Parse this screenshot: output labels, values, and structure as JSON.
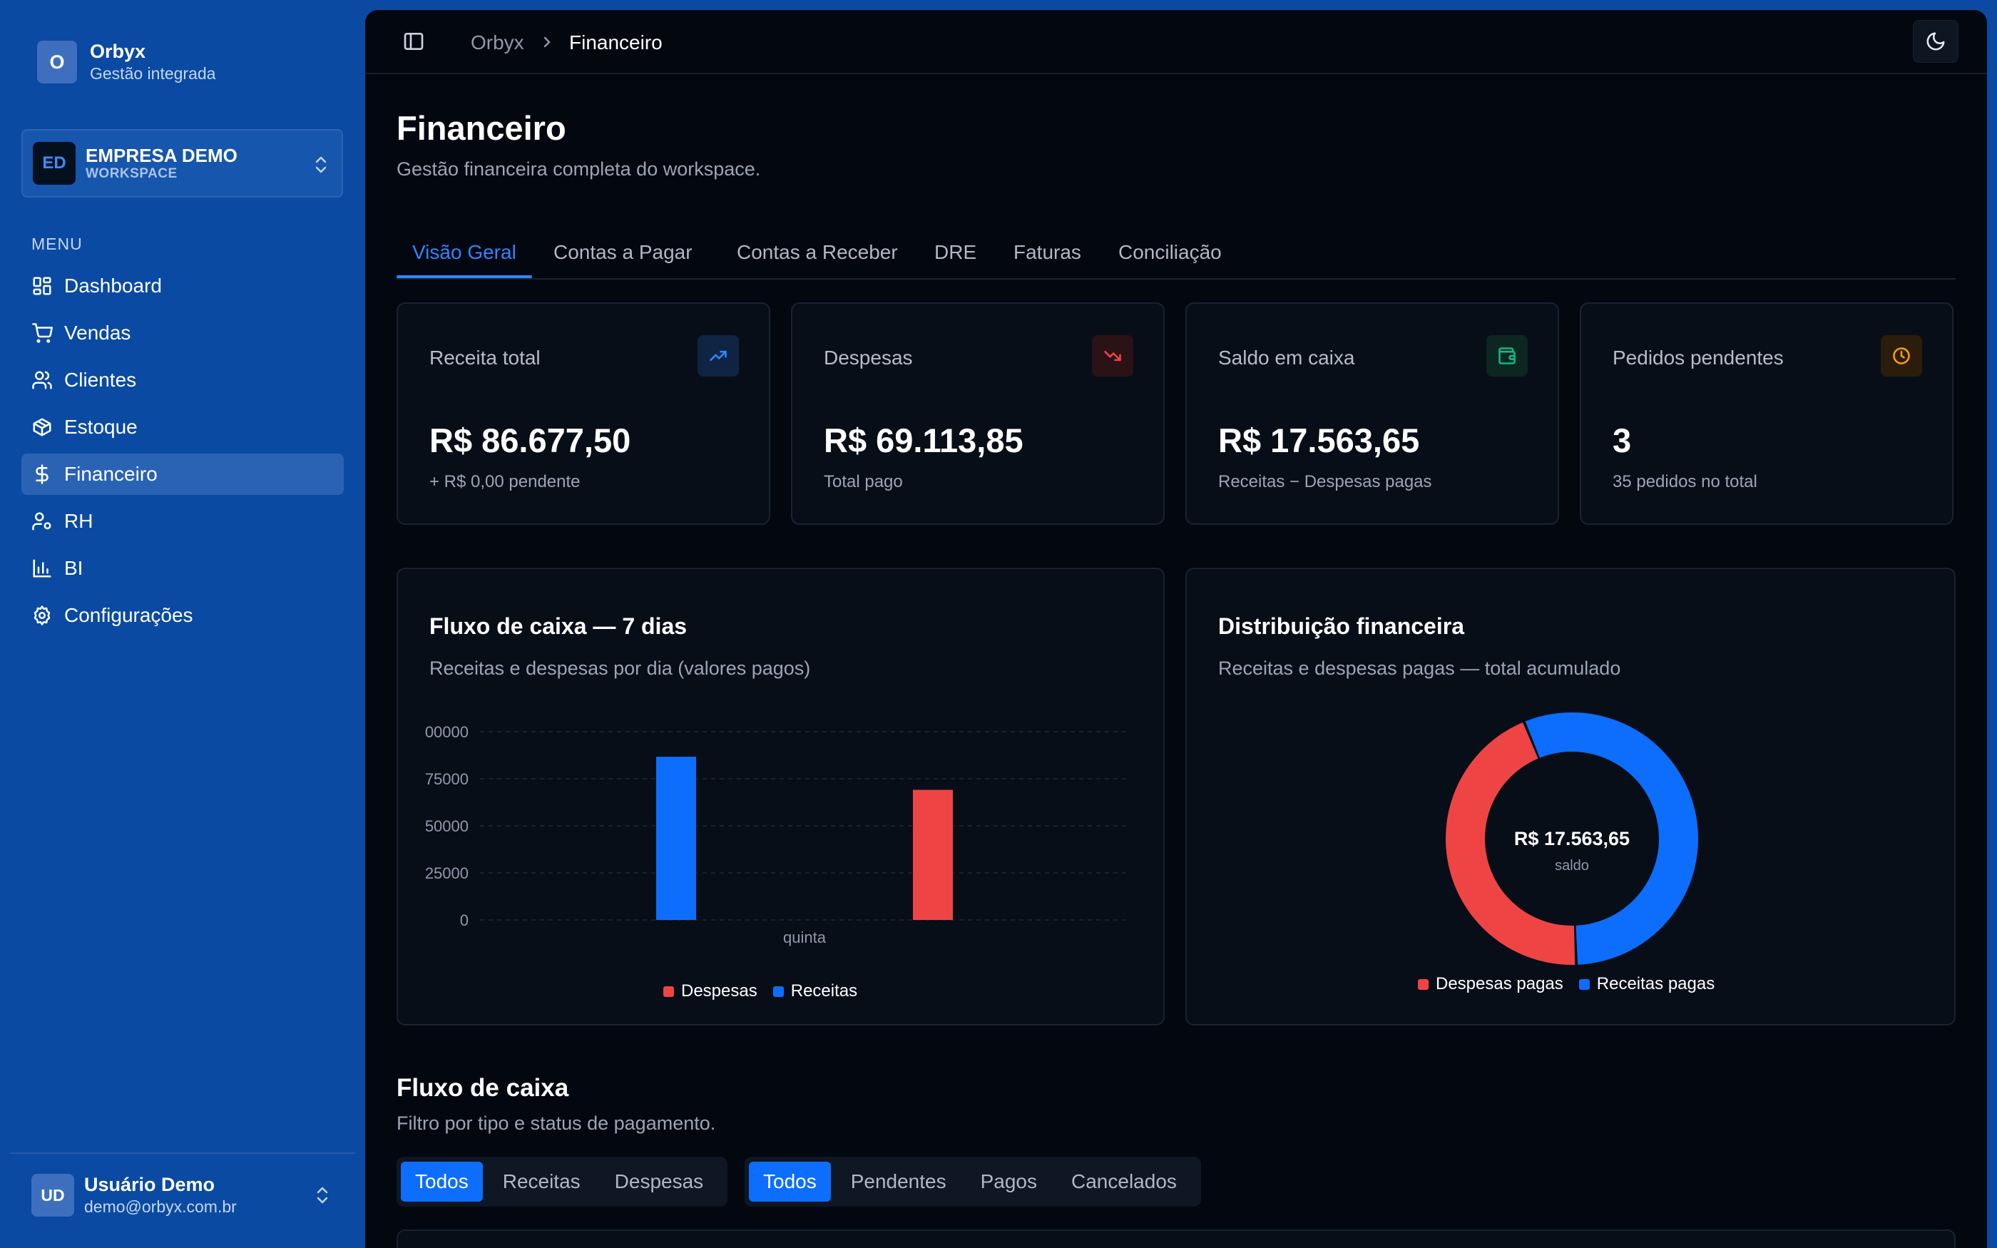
{
  "brand": {
    "initial": "O",
    "name": "Orbyx",
    "subtitle": "Gestão integrada"
  },
  "workspace": {
    "initials": "ED",
    "name": "EMPRESA DEMO",
    "label": "WORKSPACE"
  },
  "menu": {
    "label": "MENU",
    "items": [
      {
        "label": "Dashboard",
        "icon": "dashboard-icon"
      },
      {
        "label": "Vendas",
        "icon": "cart-icon"
      },
      {
        "label": "Clientes",
        "icon": "users-icon"
      },
      {
        "label": "Estoque",
        "icon": "box-icon"
      },
      {
        "label": "Financeiro",
        "icon": "dollar-icon",
        "active": true
      },
      {
        "label": "RH",
        "icon": "user-cog-icon"
      },
      {
        "label": "BI",
        "icon": "bar-chart-icon"
      },
      {
        "label": "Configurações",
        "icon": "gear-icon"
      }
    ]
  },
  "user": {
    "initials": "UD",
    "name": "Usuário Demo",
    "email": "demo@orbyx.com.br"
  },
  "breadcrumb": {
    "root": "Orbyx",
    "current": "Financeiro"
  },
  "page": {
    "title": "Financeiro",
    "subtitle": "Gestão financeira completa do workspace."
  },
  "tabs": [
    "Visão Geral",
    "Contas a Pagar",
    "Contas a Receber",
    "DRE",
    "Faturas",
    "Conciliação"
  ],
  "stats": [
    {
      "label": "Receita total",
      "value": "R$ 86.677,50",
      "note": "+ R$ 0,00 pendente",
      "icon": "trending-up-icon",
      "color": "#2e86ff"
    },
    {
      "label": "Despesas",
      "value": "R$ 69.113,85",
      "note": "Total pago",
      "icon": "trending-down-icon",
      "color": "#ef4444"
    },
    {
      "label": "Saldo em caixa",
      "value": "R$ 17.563,65",
      "note": "Receitas − Despesas pagas",
      "icon": "wallet-icon",
      "color": "#10b981"
    },
    {
      "label": "Pedidos pendentes",
      "value": "3",
      "note": "35 pedidos no total",
      "icon": "clock-icon",
      "color": "#f59e0b"
    }
  ],
  "cashflow_panel": {
    "title": "Fluxo de caixa — 7 dias",
    "subtitle": "Receitas e despesas por dia (valores pagos)",
    "legend": [
      "Despesas",
      "Receitas"
    ]
  },
  "distribution_panel": {
    "title": "Distribuição financeira",
    "subtitle": "Receitas e despesas pagas — total acumulado",
    "center_value": "R$ 17.563,65",
    "center_label": "saldo",
    "legend": [
      "Despesas pagas",
      "Receitas pagas"
    ]
  },
  "chart_data": [
    {
      "type": "bar",
      "categories": [
        "quinta"
      ],
      "series": [
        {
          "name": "Receitas",
          "values": [
            86677.5
          ],
          "color": "#0d6efd"
        },
        {
          "name": "Despesas",
          "values": [
            69113.85
          ],
          "color": "#ef4444"
        }
      ],
      "y_ticks": [
        "0",
        "25000",
        "50000",
        "75000",
        "00000"
      ],
      "ylim": [
        0,
        100000
      ],
      "grid": true
    },
    {
      "type": "pie",
      "donut": true,
      "labels": [
        "Despesas pagas",
        "Receitas pagas"
      ],
      "values": [
        69113.85,
        86677.5
      ],
      "colors": [
        "#ef4444",
        "#0d6efd"
      ]
    }
  ],
  "cashflow_section": {
    "title": "Fluxo de caixa",
    "subtitle": "Filtro por tipo e status de pagamento.",
    "type_filter": [
      "Todos",
      "Receitas",
      "Despesas"
    ],
    "status_filter": [
      "Todos",
      "Pendentes",
      "Pagos",
      "Cancelados"
    ]
  }
}
